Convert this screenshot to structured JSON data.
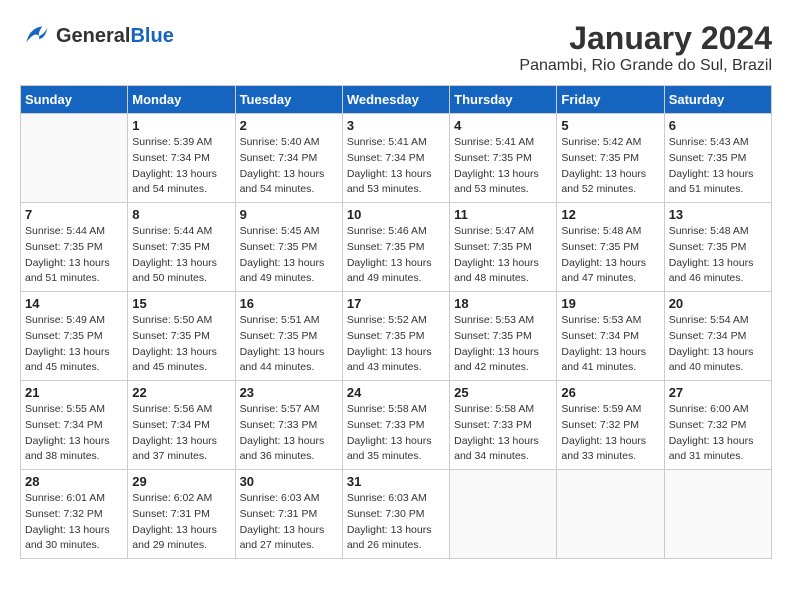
{
  "header": {
    "logo_line1": "General",
    "logo_line2": "Blue",
    "title": "January 2024",
    "subtitle": "Panambi, Rio Grande do Sul, Brazil"
  },
  "days_of_week": [
    "Sunday",
    "Monday",
    "Tuesday",
    "Wednesday",
    "Thursday",
    "Friday",
    "Saturday"
  ],
  "weeks": [
    [
      {
        "day": "",
        "info": ""
      },
      {
        "day": "1",
        "info": "Sunrise: 5:39 AM\nSunset: 7:34 PM\nDaylight: 13 hours\nand 54 minutes."
      },
      {
        "day": "2",
        "info": "Sunrise: 5:40 AM\nSunset: 7:34 PM\nDaylight: 13 hours\nand 54 minutes."
      },
      {
        "day": "3",
        "info": "Sunrise: 5:41 AM\nSunset: 7:34 PM\nDaylight: 13 hours\nand 53 minutes."
      },
      {
        "day": "4",
        "info": "Sunrise: 5:41 AM\nSunset: 7:35 PM\nDaylight: 13 hours\nand 53 minutes."
      },
      {
        "day": "5",
        "info": "Sunrise: 5:42 AM\nSunset: 7:35 PM\nDaylight: 13 hours\nand 52 minutes."
      },
      {
        "day": "6",
        "info": "Sunrise: 5:43 AM\nSunset: 7:35 PM\nDaylight: 13 hours\nand 51 minutes."
      }
    ],
    [
      {
        "day": "7",
        "info": "Sunrise: 5:44 AM\nSunset: 7:35 PM\nDaylight: 13 hours\nand 51 minutes."
      },
      {
        "day": "8",
        "info": "Sunrise: 5:44 AM\nSunset: 7:35 PM\nDaylight: 13 hours\nand 50 minutes."
      },
      {
        "day": "9",
        "info": "Sunrise: 5:45 AM\nSunset: 7:35 PM\nDaylight: 13 hours\nand 49 minutes."
      },
      {
        "day": "10",
        "info": "Sunrise: 5:46 AM\nSunset: 7:35 PM\nDaylight: 13 hours\nand 49 minutes."
      },
      {
        "day": "11",
        "info": "Sunrise: 5:47 AM\nSunset: 7:35 PM\nDaylight: 13 hours\nand 48 minutes."
      },
      {
        "day": "12",
        "info": "Sunrise: 5:48 AM\nSunset: 7:35 PM\nDaylight: 13 hours\nand 47 minutes."
      },
      {
        "day": "13",
        "info": "Sunrise: 5:48 AM\nSunset: 7:35 PM\nDaylight: 13 hours\nand 46 minutes."
      }
    ],
    [
      {
        "day": "14",
        "info": "Sunrise: 5:49 AM\nSunset: 7:35 PM\nDaylight: 13 hours\nand 45 minutes."
      },
      {
        "day": "15",
        "info": "Sunrise: 5:50 AM\nSunset: 7:35 PM\nDaylight: 13 hours\nand 45 minutes."
      },
      {
        "day": "16",
        "info": "Sunrise: 5:51 AM\nSunset: 7:35 PM\nDaylight: 13 hours\nand 44 minutes."
      },
      {
        "day": "17",
        "info": "Sunrise: 5:52 AM\nSunset: 7:35 PM\nDaylight: 13 hours\nand 43 minutes."
      },
      {
        "day": "18",
        "info": "Sunrise: 5:53 AM\nSunset: 7:35 PM\nDaylight: 13 hours\nand 42 minutes."
      },
      {
        "day": "19",
        "info": "Sunrise: 5:53 AM\nSunset: 7:34 PM\nDaylight: 13 hours\nand 41 minutes."
      },
      {
        "day": "20",
        "info": "Sunrise: 5:54 AM\nSunset: 7:34 PM\nDaylight: 13 hours\nand 40 minutes."
      }
    ],
    [
      {
        "day": "21",
        "info": "Sunrise: 5:55 AM\nSunset: 7:34 PM\nDaylight: 13 hours\nand 38 minutes."
      },
      {
        "day": "22",
        "info": "Sunrise: 5:56 AM\nSunset: 7:34 PM\nDaylight: 13 hours\nand 37 minutes."
      },
      {
        "day": "23",
        "info": "Sunrise: 5:57 AM\nSunset: 7:33 PM\nDaylight: 13 hours\nand 36 minutes."
      },
      {
        "day": "24",
        "info": "Sunrise: 5:58 AM\nSunset: 7:33 PM\nDaylight: 13 hours\nand 35 minutes."
      },
      {
        "day": "25",
        "info": "Sunrise: 5:58 AM\nSunset: 7:33 PM\nDaylight: 13 hours\nand 34 minutes."
      },
      {
        "day": "26",
        "info": "Sunrise: 5:59 AM\nSunset: 7:32 PM\nDaylight: 13 hours\nand 33 minutes."
      },
      {
        "day": "27",
        "info": "Sunrise: 6:00 AM\nSunset: 7:32 PM\nDaylight: 13 hours\nand 31 minutes."
      }
    ],
    [
      {
        "day": "28",
        "info": "Sunrise: 6:01 AM\nSunset: 7:32 PM\nDaylight: 13 hours\nand 30 minutes."
      },
      {
        "day": "29",
        "info": "Sunrise: 6:02 AM\nSunset: 7:31 PM\nDaylight: 13 hours\nand 29 minutes."
      },
      {
        "day": "30",
        "info": "Sunrise: 6:03 AM\nSunset: 7:31 PM\nDaylight: 13 hours\nand 27 minutes."
      },
      {
        "day": "31",
        "info": "Sunrise: 6:03 AM\nSunset: 7:30 PM\nDaylight: 13 hours\nand 26 minutes."
      },
      {
        "day": "",
        "info": ""
      },
      {
        "day": "",
        "info": ""
      },
      {
        "day": "",
        "info": ""
      }
    ]
  ]
}
